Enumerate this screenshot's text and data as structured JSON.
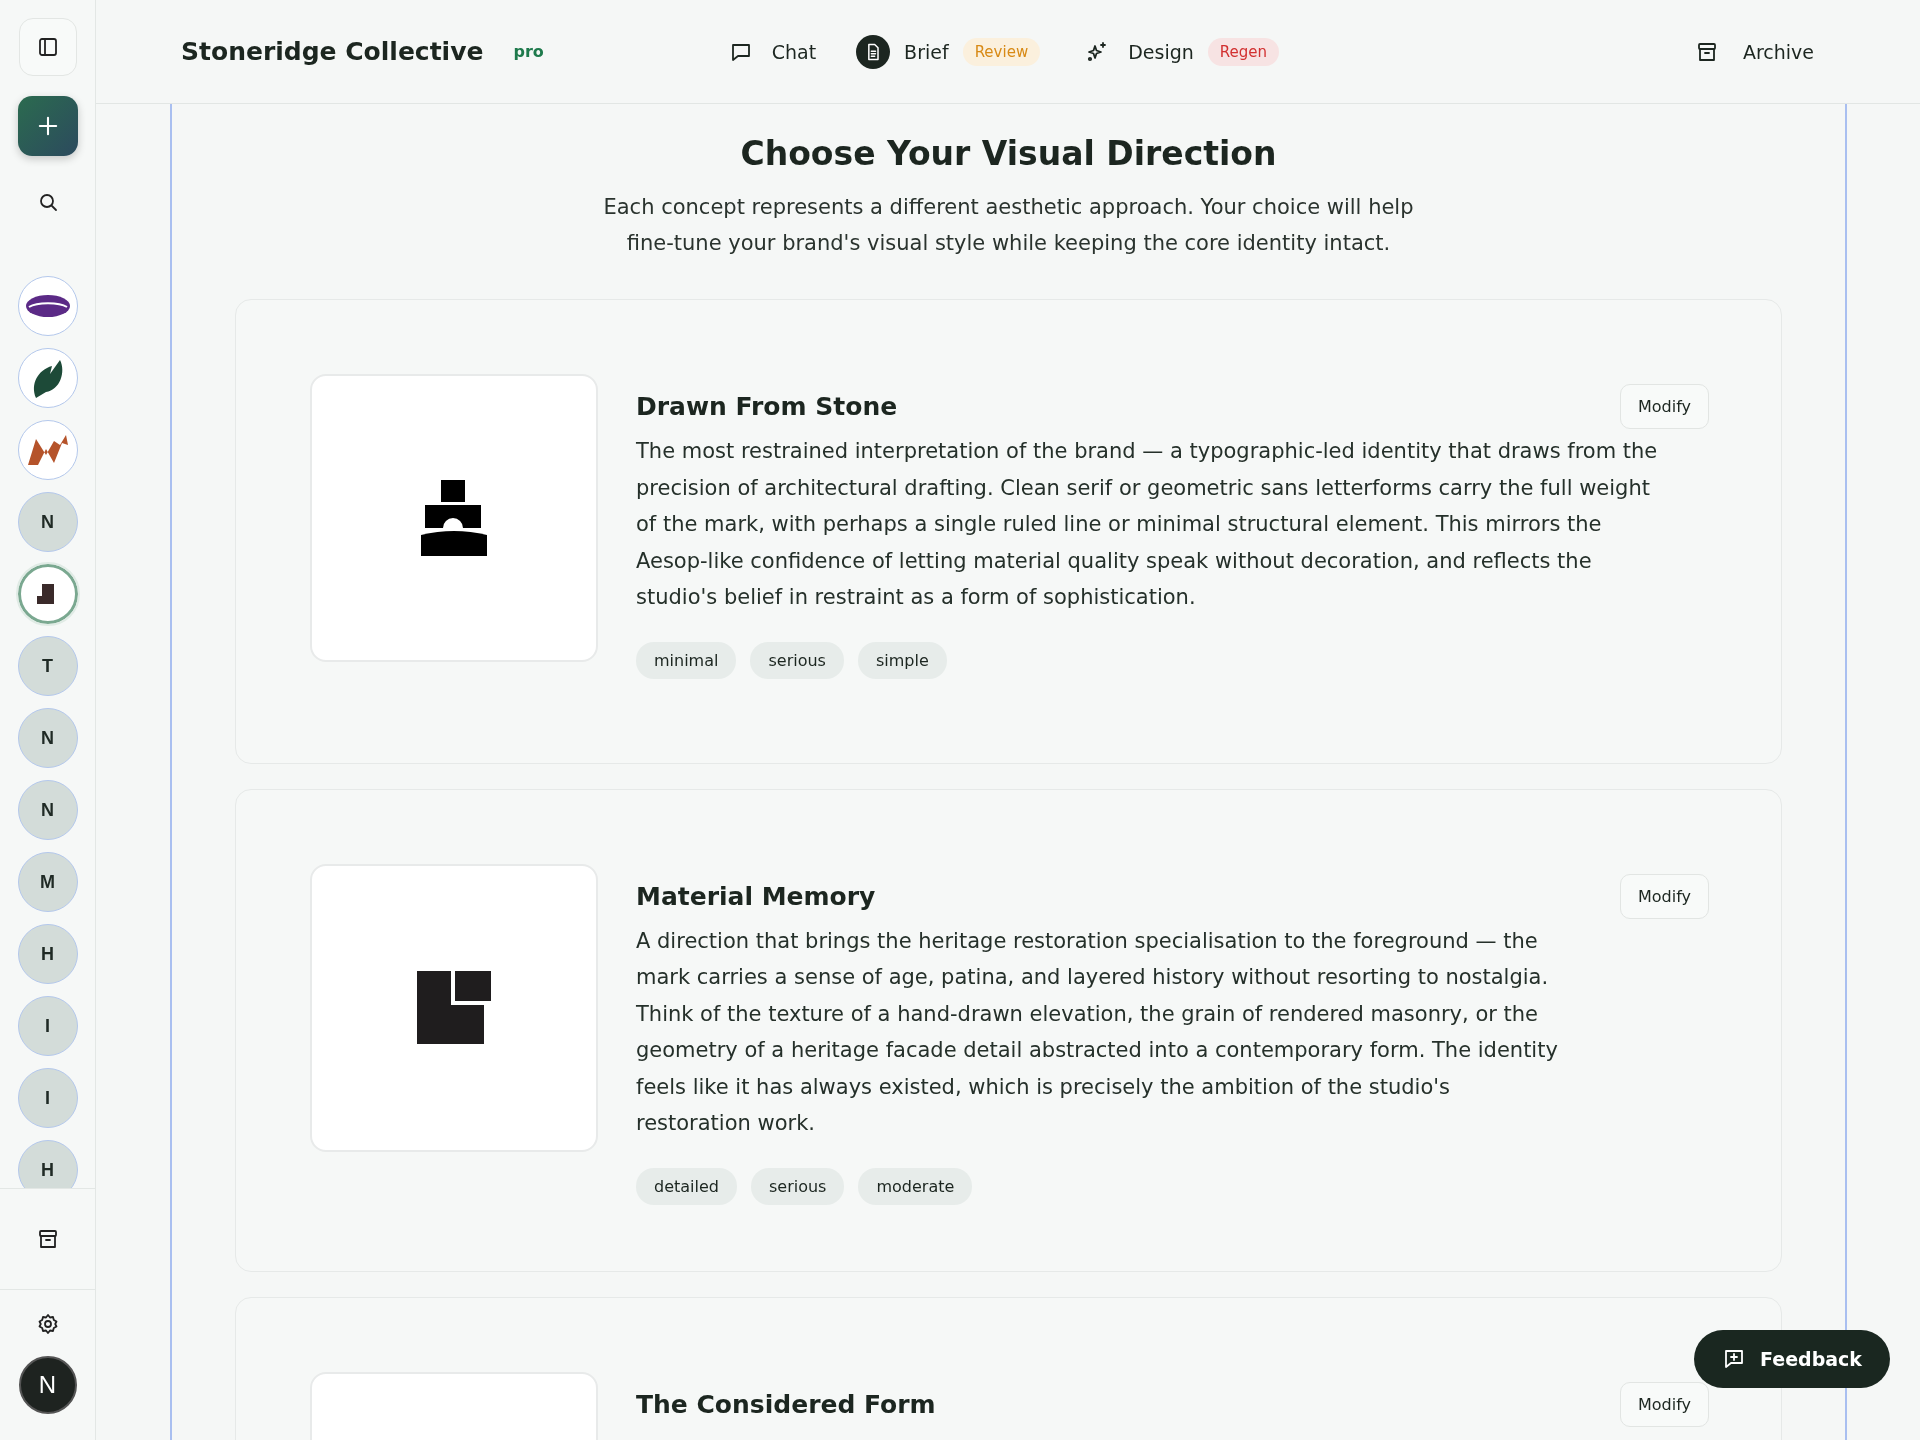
{
  "brand": {
    "name": "Stoneridge Collective",
    "plan": "pro"
  },
  "nav": [
    {
      "label": "Chat",
      "selected": false
    },
    {
      "label": "Brief",
      "selected": true,
      "badge": {
        "text": "Review",
        "kind": "warning"
      }
    },
    {
      "label": "Design",
      "selected": false,
      "badge": {
        "text": "Regen",
        "kind": "danger"
      }
    }
  ],
  "archive": "Archive",
  "sidebar": {
    "projects": [
      {
        "kind": "image",
        "selected": false
      },
      {
        "kind": "image",
        "selected": false
      },
      {
        "kind": "image",
        "selected": false
      },
      {
        "kind": "letter",
        "text": "N",
        "selected": false
      },
      {
        "kind": "image",
        "selected": true
      },
      {
        "kind": "letter",
        "text": "T",
        "selected": false
      },
      {
        "kind": "letter",
        "text": "N",
        "selected": false
      },
      {
        "kind": "letter",
        "text": "N",
        "selected": false
      },
      {
        "kind": "letter",
        "text": "M",
        "selected": false
      },
      {
        "kind": "letter",
        "text": "H",
        "selected": false
      },
      {
        "kind": "letter",
        "text": "I",
        "selected": false
      },
      {
        "kind": "letter",
        "text": "I",
        "selected": false
      },
      {
        "kind": "letter",
        "text": "H",
        "selected": false
      }
    ],
    "user": "N"
  },
  "heading": "Choose Your Visual Direction",
  "intro": "Each concept represents a different aesthetic approach. Your choice will help fine-tune your brand's visual style while keeping the core identity intact.",
  "concepts": [
    {
      "title": "Drawn From Stone",
      "action": "Modify",
      "description": "The most restrained interpretation of the brand — a typographic-led identity that draws from the precision of architectural drafting. Clean serif or geometric sans letterforms carry the full weight of the mark, with perhaps a single ruled line or minimal structural element. This mirrors the Aesop-like confidence of letting material quality speak without decoration, and reflects the studio's belief in restraint as a form of sophistication.",
      "tags": [
        "minimal",
        "serious",
        "simple"
      ]
    },
    {
      "title": "Material Memory",
      "action": "Modify",
      "description": "A direction that brings the heritage restoration specialisation to the foreground — the mark carries a sense of age, patina, and layered history without resorting to nostalgia. Think of the texture of a hand-drawn elevation, the grain of rendered masonry, or the geometry of a heritage facade detail abstracted into a contemporary form. The identity feels like it has always existed, which is precisely the ambition of the studio's restoration work.",
      "tags": [
        "detailed",
        "serious",
        "moderate"
      ]
    },
    {
      "title": "The Considered Form",
      "action": "Modify"
    }
  ],
  "feedback": "Feedback"
}
